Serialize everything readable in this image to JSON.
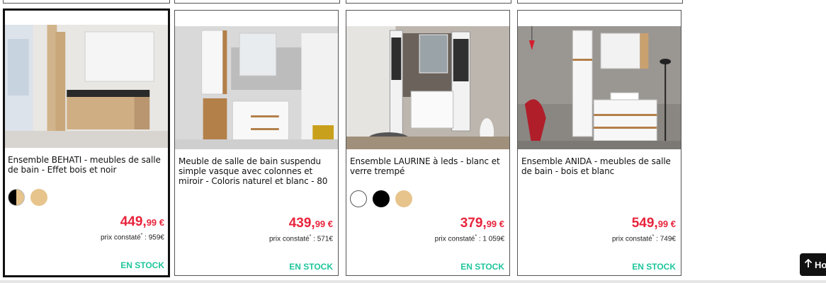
{
  "products": [
    {
      "title": "Ensemble BEHATI - meubles de salle de bain - Effet bois et noir",
      "price_main": "449,",
      "price_cents": "99 €",
      "ref_label": "prix constaté",
      "ref_value": " : 959€",
      "stock": "EN STOCK",
      "swatches": [
        "split-black-wood",
        "#e6c48c"
      ],
      "selected": true
    },
    {
      "title": "Meuble de salle de bain suspendu simple vasque avec colonnes et miroir - Coloris naturel et blanc - 80",
      "price_main": "439,",
      "price_cents": "99 €",
      "ref_label": "prix constaté",
      "ref_value": " : 571€",
      "stock": "EN STOCK",
      "swatches": [],
      "selected": false
    },
    {
      "title": "Ensemble LAURINE à leds - blanc et verre trempé",
      "price_main": "379,",
      "price_cents": "99 €",
      "ref_label": "prix constaté",
      "ref_value": " : 1 059€",
      "stock": "EN STOCK",
      "swatches": [
        "#ffffff",
        "#000000",
        "#e6c48c"
      ],
      "selected": false
    },
    {
      "title": "Ensemble ANIDA - meubles de salle de bain - bois et blanc",
      "price_main": "549,",
      "price_cents": "99 €",
      "ref_label": "prix constaté",
      "ref_value": " : 749€",
      "stock": "EN STOCK",
      "swatches": [],
      "selected": false
    }
  ],
  "home_button": {
    "label": "Ho",
    "icon": "arrow-up-icon"
  },
  "colors": {
    "price": "#e8243c",
    "stock": "#1fc69c",
    "wood": "#e6c48c"
  }
}
